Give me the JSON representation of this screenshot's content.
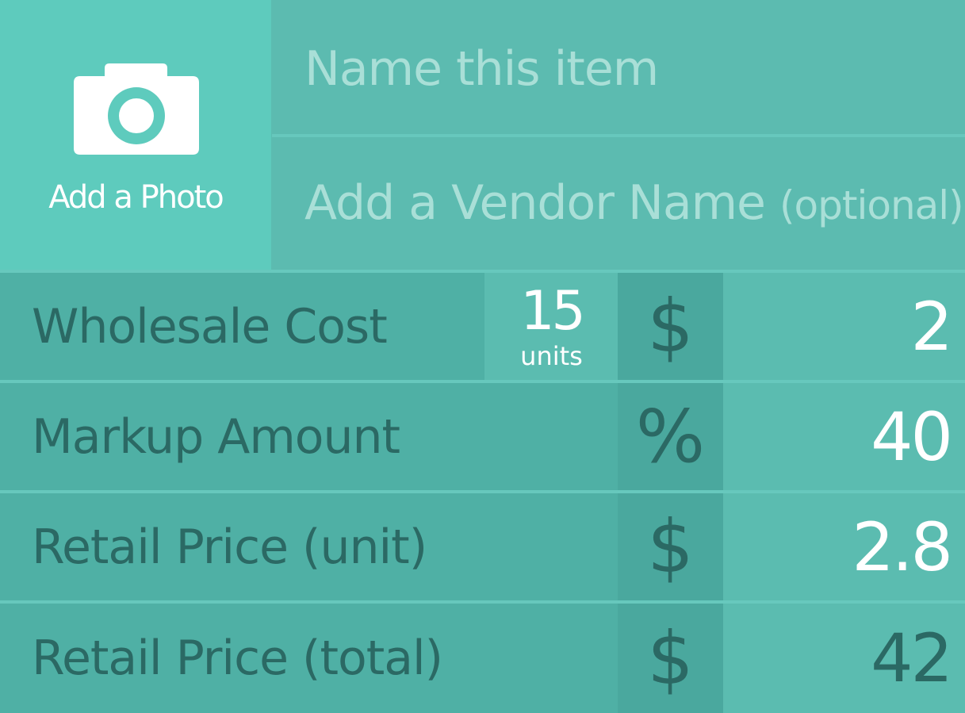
{
  "photo": {
    "label": "Add a Photo"
  },
  "item_name": {
    "placeholder": "Name this item"
  },
  "vendor": {
    "placeholder": "Add a Vendor Name",
    "optional": "(optional)"
  },
  "rows": [
    {
      "label": "Wholesale Cost",
      "units": "15",
      "units_label": "units",
      "symbol": "$",
      "value": "2",
      "value_color": "#ffffff"
    },
    {
      "label": "Markup Amount",
      "symbol": "%",
      "value": "40",
      "value_color": "#ffffff"
    },
    {
      "label": "Retail Price (unit)",
      "symbol": "$",
      "value": "2.8",
      "value_color": "#ffffff"
    },
    {
      "label": "Retail Price (total)",
      "symbol": "$",
      "value": "42",
      "value_color": "#2b6964"
    }
  ],
  "colors": {
    "accent": "#5ecbbd",
    "label_text": "#2b6964",
    "placeholder_text": "#a9dfd7"
  },
  "icons": {
    "photo": "camera-icon"
  }
}
